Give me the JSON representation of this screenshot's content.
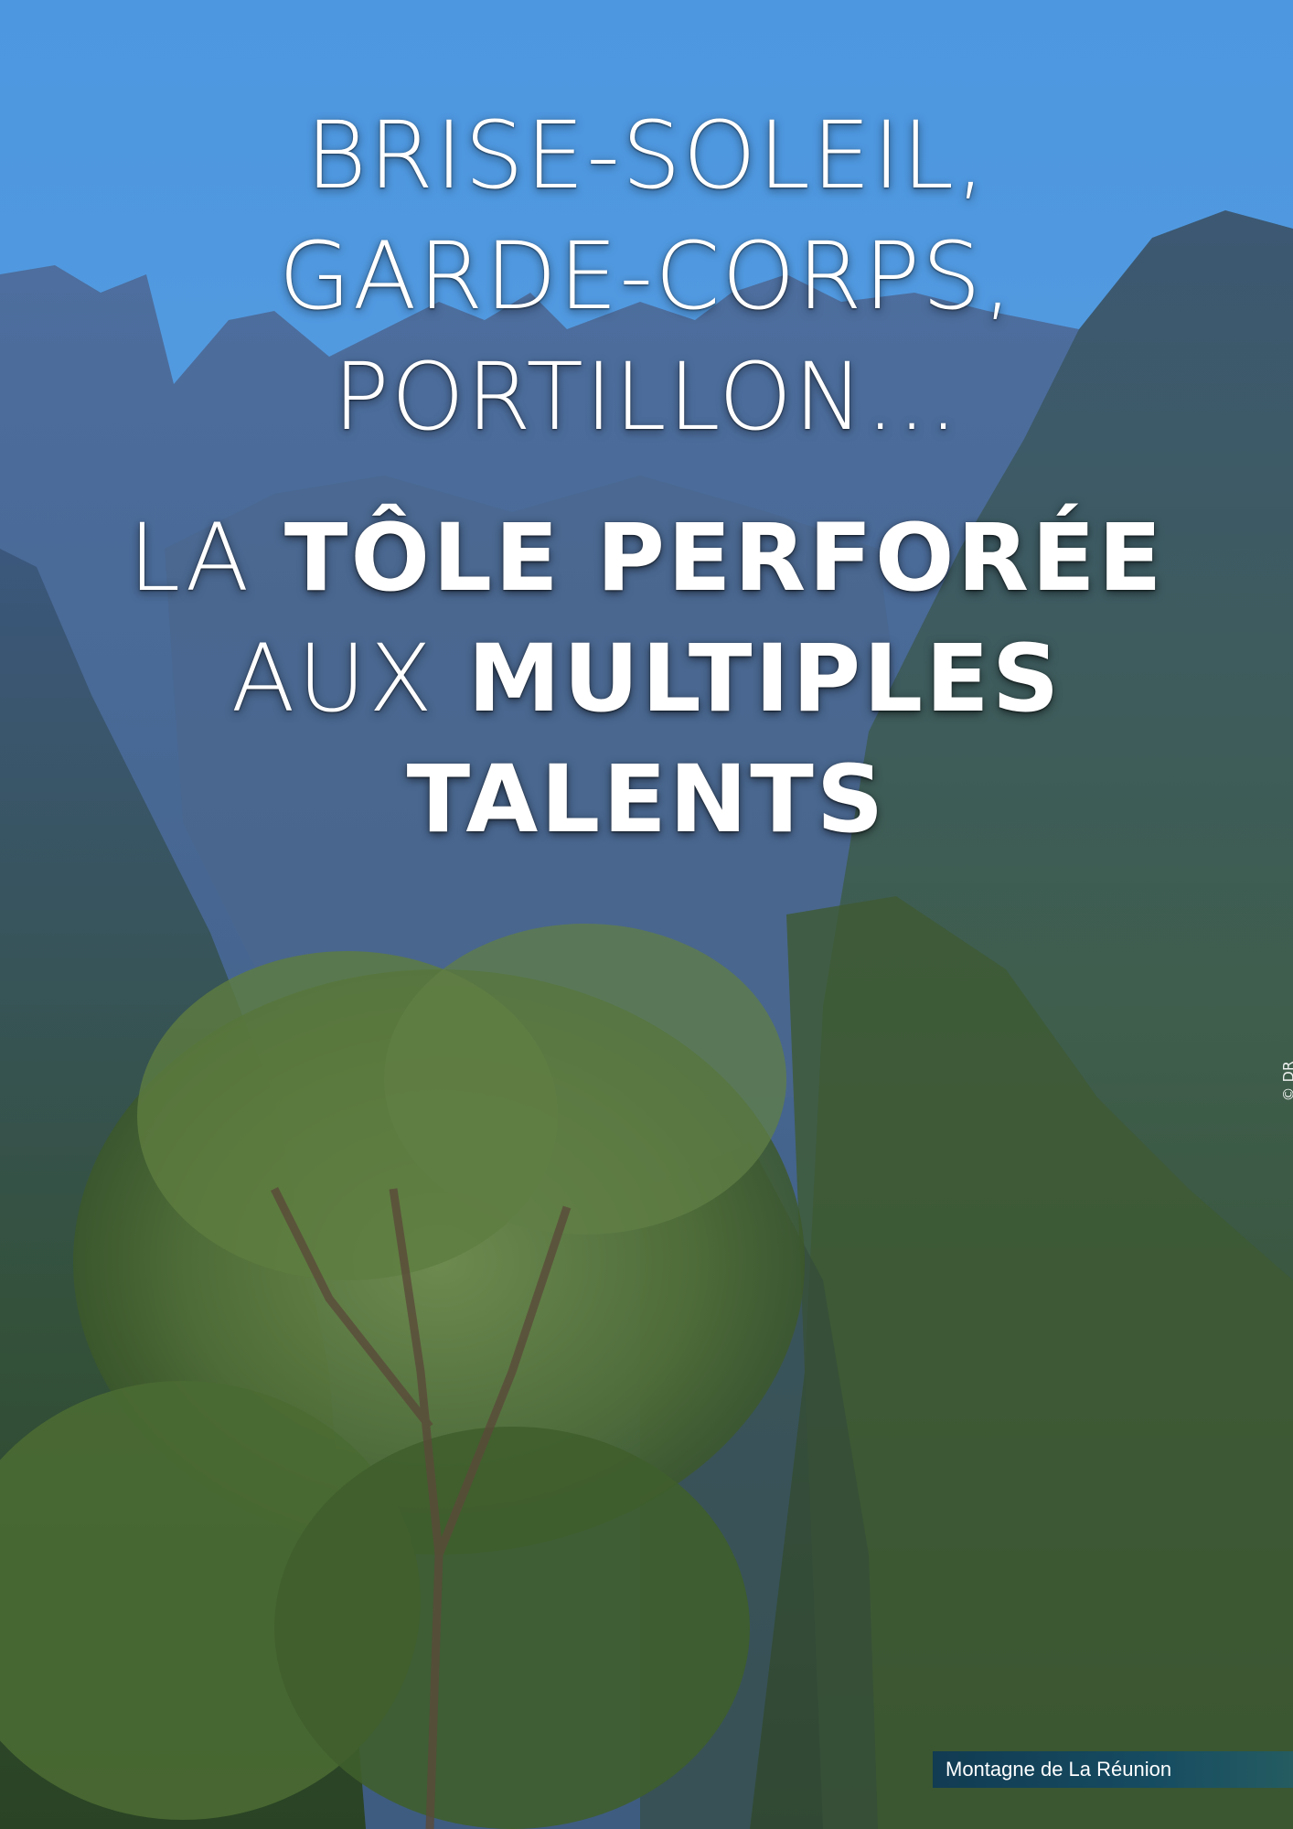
{
  "kicker": {
    "line1": "BRISE-SOLEIL,",
    "line2": "GARDE-CORPS,",
    "line3": "PORTILLON..."
  },
  "title": {
    "line1_light": "LA ",
    "line1_bold": "TÔLE PERFORÉE",
    "line2_light": "AUX ",
    "line2_bold": "MULTIPLES",
    "line3_bold": "TALENTS"
  },
  "credit": "© DR",
  "caption": "Montagne de La Réunion"
}
